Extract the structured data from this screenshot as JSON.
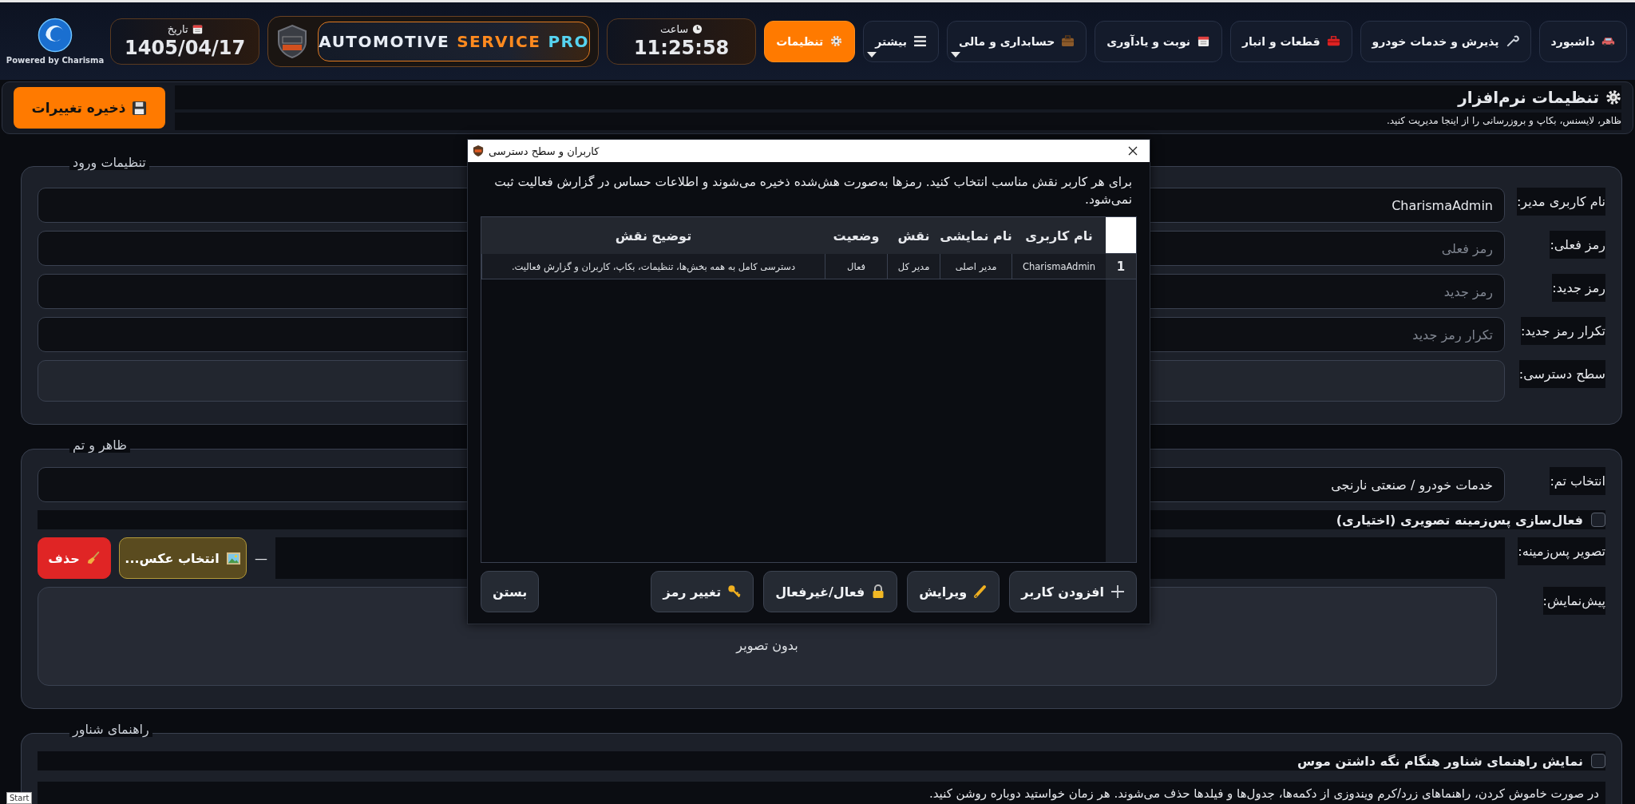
{
  "header": {
    "powered_by": "Powered by Charisma",
    "nav": [
      {
        "label": "داشبورد",
        "selected": false,
        "dropdown": false
      },
      {
        "label": "پذیرش و خدمات خودرو",
        "selected": false,
        "dropdown": false
      },
      {
        "label": "قطعات و انبار",
        "selected": false,
        "dropdown": false
      },
      {
        "label": "نوبت و یادآوری",
        "selected": false,
        "dropdown": false
      },
      {
        "label": "حسابداری و مالی",
        "selected": false,
        "dropdown": true
      },
      {
        "label": "بیشتر",
        "selected": false,
        "dropdown": true
      },
      {
        "label": "تنظیمات",
        "selected": true,
        "dropdown": false
      }
    ],
    "time_label": "ساعت",
    "time": "11:25:58",
    "brand": {
      "word_1": {
        "text": "AUTOMOTIVE",
        "color": "#e8edf5"
      },
      "word_2": {
        "text": "SERVICE",
        "color": "#ff8a1f"
      },
      "word_3": {
        "text": "PRO",
        "color": "#56d3f0"
      }
    },
    "date_label": "تاریخ",
    "date": "1405/04/17"
  },
  "page_header": {
    "title": "تنظیمات نرم‌افزار",
    "subtitle": "ظاهر، لایسنس، بکاپ و بروزرسانی را از اینجا مدیریت کنید.",
    "save_button": "ذخیره تغییرات"
  },
  "login_section": {
    "title": "تنظیمات ورود",
    "fields": [
      {
        "kind": "text",
        "label": "نام کاربری مدیر:",
        "value": "CharismaAdmin"
      },
      {
        "kind": "text",
        "label": "رمز فعلی:",
        "placeholder": "رمز فعلی"
      },
      {
        "kind": "text",
        "label": "رمز جدید:",
        "placeholder": "رمز جدید"
      },
      {
        "kind": "text",
        "label": "تکرار رمز جدید:",
        "placeholder": "تکرار رمز جدید"
      },
      {
        "kind": "select",
        "label": "سطح دسترسی:"
      }
    ]
  },
  "theme_section": {
    "title": "ظاهر و تم",
    "theme_label": "انتخاب تم:",
    "theme_value": "خدمات خودرو / صنعتی نارنجی",
    "background_checkbox": {
      "label": "فعال‌سازی پس‌زمینه تصویری (اختیاری)",
      "checked": false
    },
    "background_label": "تصویر پس‌زمینه:",
    "background_path": "—",
    "choose_button": "انتخاب عکس...",
    "delete_button": "حذف",
    "preview_label": "پیش‌نمایش:",
    "preview_text": "بدون تصویر"
  },
  "tooltip_section": {
    "title": "راهنمای شناور",
    "checkbox": {
      "label": "نمایش راهنمای شناور هنگام نگه داشتن موس",
      "checked": false
    },
    "note": "در صورت خاموش کردن، راهنماهای زرد/کرم ویندوزی از دکمه‌ها، جدول‌ها و فیلدها حذف می‌شوند. هر زمان خواستید دوباره روشن کنید."
  },
  "dialog": {
    "title": "کاربران و سطح دسترسی",
    "intro": "برای هر کاربر نقش مناسب انتخاب کنید. رمزها به‌صورت هش‌شده ذخیره می‌شوند و اطلاعات حساس در گزارش فعالیت ثبت نمی‌شود.",
    "columns": [
      "نام کاربری",
      "نام نمایشی",
      "نقش",
      "وضعیت",
      "توضیح نقش"
    ],
    "rows": [
      {
        "number": "1",
        "cells": [
          "CharismaAdmin",
          "مدیر اصلی",
          "مدیر کل",
          "فعال",
          "دسترسی کامل به همه بخش‌ها، تنظیمات، بکاپ، کاربران و گزارش فعالیت."
        ]
      }
    ],
    "buttons": [
      "افزودن کاربر",
      "ویرایش",
      "فعال/غیرفعال",
      "تغییر رمز"
    ],
    "close_button": "بستن"
  },
  "taskbar_hint": "Start"
}
